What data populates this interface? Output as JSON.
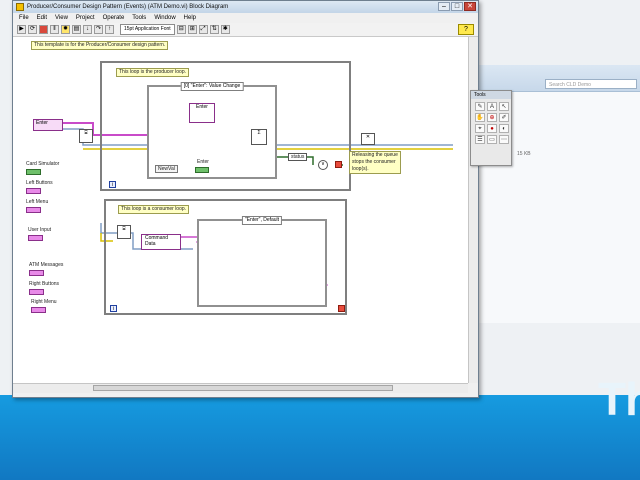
{
  "window": {
    "title": "Producer/Consumer Design Pattern (Events) (ATM Demo.vi) Block Diagram",
    "controls": {
      "minimize": "–",
      "maximize": "□",
      "close": "✕"
    }
  },
  "menu": [
    "File",
    "Edit",
    "View",
    "Project",
    "Operate",
    "Tools",
    "Window",
    "Help"
  ],
  "toolbar": {
    "font": "15pt Application Font",
    "icons": [
      "run-arrow-icon",
      "run-continuous-icon",
      "abort-icon",
      "pause-icon",
      "highlight-icon",
      "retain-icon",
      "step-into-icon",
      "step-over-icon",
      "step-out-icon",
      "align-icon",
      "distribute-icon",
      "resize-icon",
      "reorder-icon",
      "cleanup-icon"
    ],
    "help": "?"
  },
  "diagram": {
    "template_note": "This template is for the Producer/Consumer design pattern.",
    "producer_note": "This loop is the producer loop.",
    "consumer_note": "This loop is a consumer loop.",
    "release_note": "Releasing the queue\nstops the consumer\nloop(s).",
    "event_case_label": "[0] \"Enter\": Value Change",
    "consumer_case_label": "\"Enter\", Default",
    "enter_ctl": "Enter",
    "enter_inner": "Enter",
    "new_val": "NewVal",
    "enter_indicator": "Enter",
    "status": "status",
    "command": "Command",
    "data": "Data",
    "iter_i": "i",
    "side_labels": [
      "Card Simulator",
      "Left Buttons",
      "Left Menu",
      "User Input",
      "ATM Messages",
      "Right Buttons",
      "Right Menu"
    ]
  },
  "tools_palette": {
    "title": "Tools",
    "items": [
      "✎",
      "A",
      "↖",
      "✋",
      "⊕",
      "✐",
      "⌖",
      "●",
      "◐",
      "☰",
      "▭",
      "⋯"
    ]
  },
  "explorer": {
    "search": "Search CLD Demo",
    "size": "15 KB"
  },
  "desktop": {
    "brand": "Th"
  }
}
